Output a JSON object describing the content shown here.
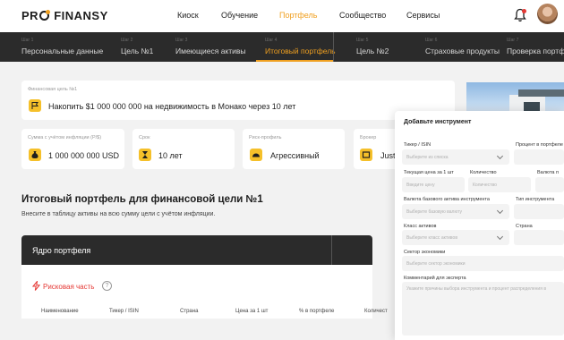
{
  "header": {
    "logo": {
      "pre": "PR",
      "post": "FINANSY"
    },
    "nav": [
      {
        "label": "Киоск",
        "active": false
      },
      {
        "label": "Обучение",
        "active": false
      },
      {
        "label": "Портфель",
        "active": true
      },
      {
        "label": "Сообщество",
        "active": false
      },
      {
        "label": "Сервисы",
        "active": false
      }
    ]
  },
  "steps": [
    {
      "num": "Шаг 1",
      "label": "Персональные данные"
    },
    {
      "num": "Шаг 2",
      "label": "Цель №1"
    },
    {
      "num": "Шаг 3",
      "label": "Имеющиеся активы"
    },
    {
      "num": "Шаг 4",
      "label": "Итоговый портфель",
      "active": true
    },
    {
      "num": "Шаг 5",
      "label": "Цель №2"
    },
    {
      "num": "Шаг 6",
      "label": "Страховые продукты"
    },
    {
      "num": "Шаг 7",
      "label": "Проверка портфе"
    }
  ],
  "goal": {
    "label": "Финансовая цель №1",
    "text": "Накопить $1 000 000 000 на недвижимость в Монако через 10 лет"
  },
  "metrics": [
    {
      "label": "Сумма с учётом инфляции (Р/$)",
      "value": "1 000 000 000 USD"
    },
    {
      "label": "Срок",
      "value": "10 лет"
    },
    {
      "label": "Риск-профиль",
      "value": "Агрессивный"
    },
    {
      "label": "Брокер",
      "value": "Just"
    }
  ],
  "portfolio": {
    "title": "Итоговый портфель для финансовой цели №1",
    "subtitle": "Внесите в таблицу активы на всю сумму цели с учётом инфляции.",
    "core_title": "Ядро портфеля",
    "risk_label": "Рисковая часть",
    "help": "?",
    "columns": [
      "Наименование",
      "Тикер / ISIN",
      "Страна",
      "Цена за 1 шт",
      "% в портфеле",
      "Количест"
    ]
  },
  "panel": {
    "title": "Добавьте инструмент",
    "fields": {
      "ticker": {
        "label": "Тикер / ISIN",
        "placeholder": "Выберите из списка"
      },
      "percent": {
        "label": "Процент в портфеле"
      },
      "price": {
        "label": "Текущая цена за 1 шт",
        "placeholder": "Введите цену"
      },
      "quantity": {
        "label": "Количество",
        "placeholder": "Количество"
      },
      "currency": {
        "label": "Валюта п"
      },
      "base_currency": {
        "label": "Валюта базового актива инструмента",
        "placeholder": "Выберите базовую валюту"
      },
      "instrument_type": {
        "label": "Тип инструмента"
      },
      "asset_class": {
        "label": "Класс активов",
        "placeholder": "Выберите класс активов"
      },
      "country": {
        "label": "Страна"
      },
      "sector": {
        "label": "Сектор экономики",
        "placeholder": "Выберите сектор экономики"
      },
      "comment": {
        "label": "Комментарий для эксперта",
        "placeholder": "Укажите причины выбора инструмента и процент распределения в"
      }
    }
  }
}
